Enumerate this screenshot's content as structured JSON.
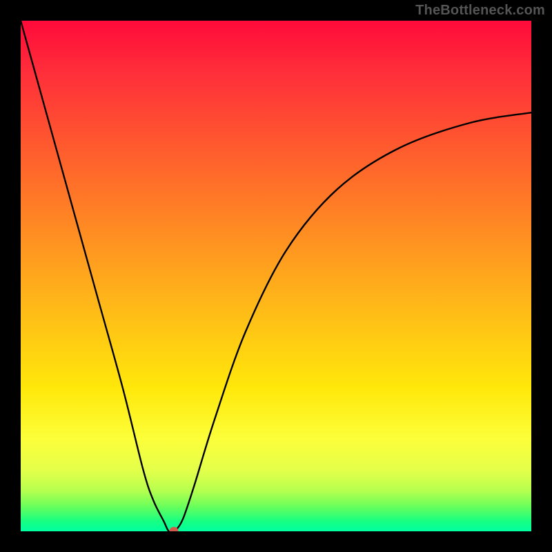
{
  "watermark": "TheBottleneck.com",
  "chart_data": {
    "type": "line",
    "title": "",
    "xlabel": "",
    "ylabel": "",
    "xlim": [
      0,
      100
    ],
    "ylim": [
      0,
      100
    ],
    "grid": false,
    "legend": false,
    "background_gradient": {
      "top": "#ff0a3a",
      "mid": "#ffe80a",
      "bottom": "#00ffa0"
    },
    "series": [
      {
        "name": "bottleneck-curve",
        "x": [
          0,
          5,
          10,
          15,
          20,
          24,
          26,
          28,
          29,
          30,
          31,
          32,
          34,
          38,
          44,
          52,
          62,
          74,
          88,
          100
        ],
        "values": [
          100,
          82,
          64,
          46,
          28,
          12,
          6,
          2,
          0,
          0,
          1,
          3,
          9,
          22,
          39,
          55,
          67,
          75,
          80,
          82
        ]
      }
    ],
    "marker": {
      "name": "optimal-point",
      "x": 30,
      "y": 0,
      "color": "#d45a4a"
    }
  }
}
